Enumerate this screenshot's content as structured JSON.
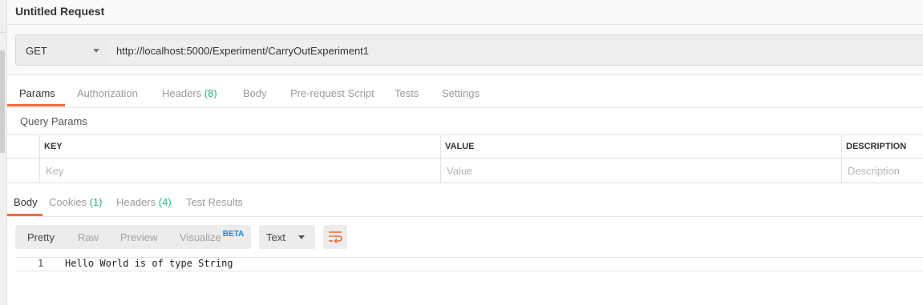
{
  "request": {
    "title": "Untitled Request",
    "method": "GET",
    "url": "http://localhost:5000/Experiment/CarryOutExperiment1"
  },
  "request_tabs": [
    {
      "label": "Params",
      "active": true
    },
    {
      "label": "Authorization"
    },
    {
      "label": "Headers",
      "count": "(8)"
    },
    {
      "label": "Body"
    },
    {
      "label": "Pre-request Script"
    },
    {
      "label": "Tests"
    },
    {
      "label": "Settings"
    }
  ],
  "query_params": {
    "title": "Query Params",
    "columns": {
      "key": "KEY",
      "value": "VALUE",
      "description": "DESCRIPTION"
    },
    "placeholders": {
      "key": "Key",
      "value": "Value",
      "description": "Description"
    }
  },
  "response_tabs": [
    {
      "label": "Body",
      "active": true
    },
    {
      "label": "Cookies",
      "count": "(1)"
    },
    {
      "label": "Headers",
      "count": "(4)"
    },
    {
      "label": "Test Results"
    }
  ],
  "response_toolbar": {
    "view_modes": [
      "Pretty",
      "Raw",
      "Preview",
      "Visualize"
    ],
    "active_view": "Pretty",
    "beta_badge": "BETA",
    "format": "Text",
    "wrap_icon": "wrap-lines-icon"
  },
  "response_body": {
    "lines": [
      {
        "number": "1",
        "text": "Hello World is of type String"
      }
    ]
  },
  "colors": {
    "accent": "#f26b3a",
    "count": "#26b47f",
    "beta": "#1c84e0"
  }
}
